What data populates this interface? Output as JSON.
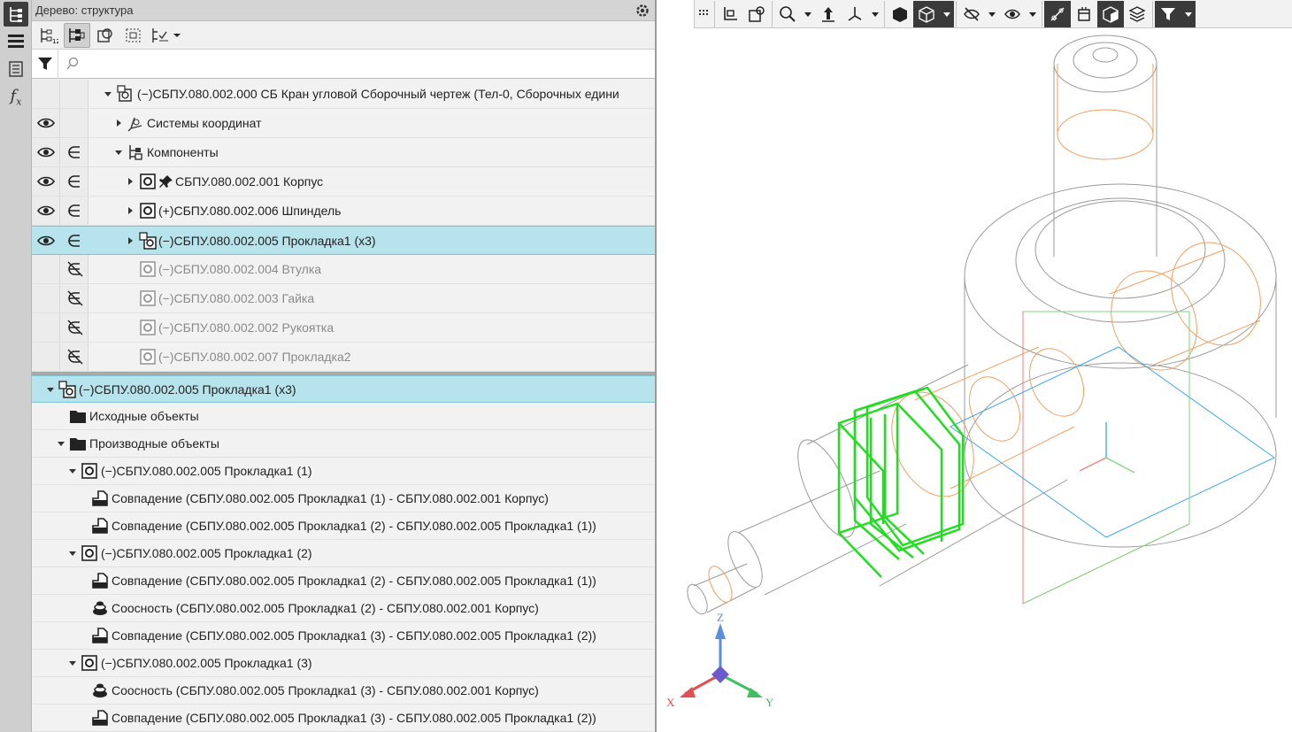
{
  "rail": {
    "items": [
      {
        "name": "tree-icon",
        "active": true
      },
      {
        "name": "menu-icon",
        "active": false
      },
      {
        "name": "properties-icon",
        "active": false
      },
      {
        "name": "function-icon",
        "label": "fx",
        "active": false
      }
    ]
  },
  "panel": {
    "title": "Дерево: структура",
    "search_placeholder": "",
    "search_value": ""
  },
  "tree": {
    "root": "(−)СБПУ.080.002.000 СБ Кран угловой Сборочный чертеж (Тел-0, Сборочных едини",
    "rows": [
      {
        "label": "Системы координат"
      },
      {
        "label": "Компоненты"
      },
      {
        "label": "СБПУ.080.002.001 Корпус"
      },
      {
        "label": "(+)СБПУ.080.002.006 Шпиндель"
      },
      {
        "label": "(−)СБПУ.080.002.005 Прокладка1 (х3)"
      },
      {
        "label": "(−)СБПУ.080.002.004 Втулка"
      },
      {
        "label": "(−)СБПУ.080.002.003 Гайка"
      },
      {
        "label": "(−)СБПУ.080.002.002 Рукоятка"
      },
      {
        "label": "(−)СБПУ.080.002.007 Прокладка2"
      }
    ]
  },
  "relations": {
    "header": "(−)СБПУ.080.002.005 Прокладка1 (х3)",
    "rows": [
      {
        "label": "Исходные объекты"
      },
      {
        "label": "Производные объекты"
      },
      {
        "label": "(−)СБПУ.080.002.005 Прокладка1 (1)"
      },
      {
        "label": "Совпадение (СБПУ.080.002.005 Прокладка1 (1)  -  СБПУ.080.002.001 Корпус)"
      },
      {
        "label": "Совпадение (СБПУ.080.002.005 Прокладка1 (2)  -  СБПУ.080.002.005 Прокладка1 (1))"
      },
      {
        "label": "(−)СБПУ.080.002.005 Прокладка1 (2)"
      },
      {
        "label": "Совпадение (СБПУ.080.002.005 Прокладка1 (2)  -  СБПУ.080.002.005 Прокладка1 (1))"
      },
      {
        "label": "Соосность (СБПУ.080.002.005 Прокладка1 (2)  -  СБПУ.080.002.001 Корпус)"
      },
      {
        "label": "Совпадение (СБПУ.080.002.005 Прокладка1 (3)  -  СБПУ.080.002.005 Прокладка1 (2))"
      },
      {
        "label": "(−)СБПУ.080.002.005 Прокладка1 (3)"
      },
      {
        "label": "Соосность (СБПУ.080.002.005 Прокладка1 (3)  -  СБПУ.080.002.001 Корпус)"
      },
      {
        "label": "Совпадение (СБПУ.080.002.005 Прокладка1 (3)  -  СБПУ.080.002.005 Прокладка1 (2))"
      }
    ]
  },
  "axes": {
    "x": "X",
    "y": "Y",
    "z": "Z"
  },
  "colors": {
    "selection": "#b7e3ec",
    "highlight_green": "#22dd22",
    "wire_orange": "#f0a060",
    "wire_gray": "#9a9a9a",
    "plane_red": "#f08080",
    "plane_green": "#7fd67f",
    "plane_blue": "#3fa9e8"
  }
}
